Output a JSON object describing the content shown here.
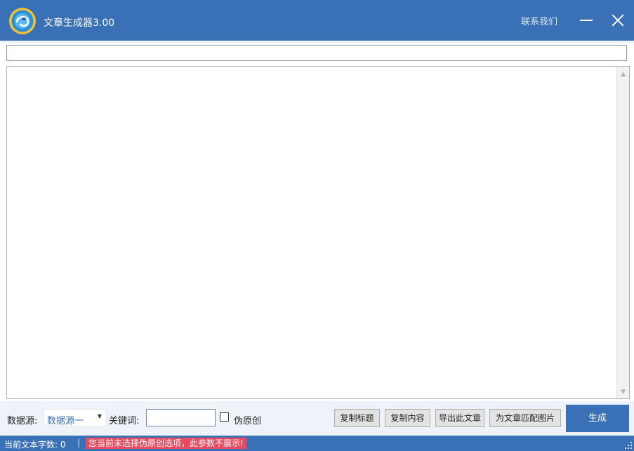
{
  "window": {
    "title": "文章生成器3.00",
    "contact_label": "联系我们",
    "minimize_icon": "minimize-icon",
    "close_icon": "close-icon"
  },
  "editor": {
    "title_value": "",
    "content_value": ""
  },
  "controls": {
    "source_label": "数据源:",
    "source_selected": "数据源一",
    "keyword_label": "关键词:",
    "keyword_value": "",
    "pseudo_original_label": "伪原创",
    "pseudo_original_checked": false,
    "buttons": {
      "copy_title": "复制标题",
      "copy_content": "复制内容",
      "export_article": "导出此文章",
      "match_images": "为文章匹配图片",
      "generate": "生成"
    }
  },
  "status": {
    "char_count_label": "当前文本字数: 0",
    "separator": "|",
    "warning": "您当前未选择伪原创选项，此参数不展示!"
  },
  "colors": {
    "accent": "#3a70b6",
    "warning_bg": "#e84a5f",
    "controls_bg": "#eef3fa"
  }
}
